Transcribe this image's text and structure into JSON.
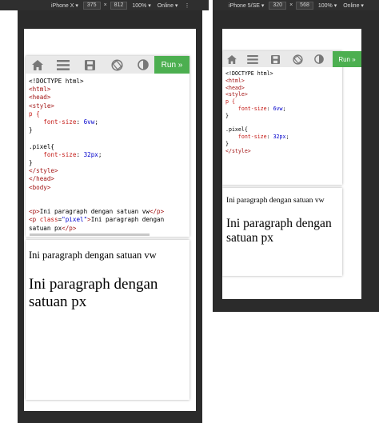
{
  "devices": [
    {
      "name": "iPhone X",
      "width": "375",
      "height": "812",
      "zoom": "100%",
      "network": "Online",
      "run_label": "Run »",
      "code_lines": [
        [
          {
            "t": "<!DOCTYPE html>",
            "c": ""
          }
        ],
        [
          {
            "t": "<html>",
            "c": "tag"
          }
        ],
        [
          {
            "t": "<head>",
            "c": "tag"
          }
        ],
        [
          {
            "t": "<style>",
            "c": "tag"
          }
        ],
        [
          {
            "t": "p {",
            "c": "prop"
          }
        ],
        [
          {
            "t": "    font-size",
            "c": "prop"
          },
          {
            "t": ": ",
            "c": ""
          },
          {
            "t": "6vw",
            "c": "val"
          },
          {
            "t": ";",
            "c": ""
          }
        ],
        [
          {
            "t": "}",
            "c": ""
          }
        ],
        [
          {
            "t": "",
            "c": ""
          }
        ],
        [
          {
            "t": ".pixel{",
            "c": ""
          }
        ],
        [
          {
            "t": "    font-size",
            "c": "prop"
          },
          {
            "t": ": ",
            "c": ""
          },
          {
            "t": "32px",
            "c": "val"
          },
          {
            "t": ";",
            "c": ""
          }
        ],
        [
          {
            "t": "}",
            "c": ""
          }
        ],
        [
          {
            "t": "</style>",
            "c": "tag"
          }
        ],
        [
          {
            "t": "</head>",
            "c": "tag"
          }
        ],
        [
          {
            "t": "<body>",
            "c": "tag"
          }
        ],
        [
          {
            "t": "",
            "c": ""
          }
        ],
        [
          {
            "t": "",
            "c": ""
          }
        ],
        [
          {
            "t": "<p>",
            "c": "tag"
          },
          {
            "t": "Ini paragraph dengan satuan vw",
            "c": ""
          },
          {
            "t": "</p>",
            "c": "tag"
          }
        ],
        [
          {
            "t": "<p ",
            "c": "tag"
          },
          {
            "t": "class",
            "c": "attr"
          },
          {
            "t": "=",
            "c": ""
          },
          {
            "t": "\"pixel\"",
            "c": "str"
          },
          {
            "t": ">",
            "c": "tag"
          },
          {
            "t": "Ini paragraph dengan",
            "c": ""
          }
        ],
        [
          {
            "t": "satuan px",
            "c": ""
          },
          {
            "t": "</p>",
            "c": "tag"
          }
        ]
      ],
      "output_vw": "Ini paragraph dengan satuan vw",
      "output_px": "Ini paragraph dengan satuan px"
    },
    {
      "name": "iPhone 5/SE",
      "width": "320",
      "height": "568",
      "zoom": "100%",
      "network": "Online",
      "run_label": "Run »",
      "code_lines": [
        [
          {
            "t": "<!DOCTYPE html>",
            "c": ""
          }
        ],
        [
          {
            "t": "<html>",
            "c": "tag"
          }
        ],
        [
          {
            "t": "<head>",
            "c": "tag"
          }
        ],
        [
          {
            "t": "<style>",
            "c": "tag"
          }
        ],
        [
          {
            "t": "p {",
            "c": "prop"
          }
        ],
        [
          {
            "t": "    font-size",
            "c": "prop"
          },
          {
            "t": ": ",
            "c": ""
          },
          {
            "t": "6vw",
            "c": "val"
          },
          {
            "t": ";",
            "c": ""
          }
        ],
        [
          {
            "t": "}",
            "c": ""
          }
        ],
        [
          {
            "t": "",
            "c": ""
          }
        ],
        [
          {
            "t": ".pixel{",
            "c": ""
          }
        ],
        [
          {
            "t": "    font-size",
            "c": "prop"
          },
          {
            "t": ": ",
            "c": ""
          },
          {
            "t": "32px",
            "c": "val"
          },
          {
            "t": ";",
            "c": ""
          }
        ],
        [
          {
            "t": "}",
            "c": ""
          }
        ],
        [
          {
            "t": "</style>",
            "c": "tag"
          }
        ]
      ],
      "output_vw": "Ini paragraph dengan satuan vw",
      "output_px": "Ini paragraph dengan satuan px"
    }
  ]
}
